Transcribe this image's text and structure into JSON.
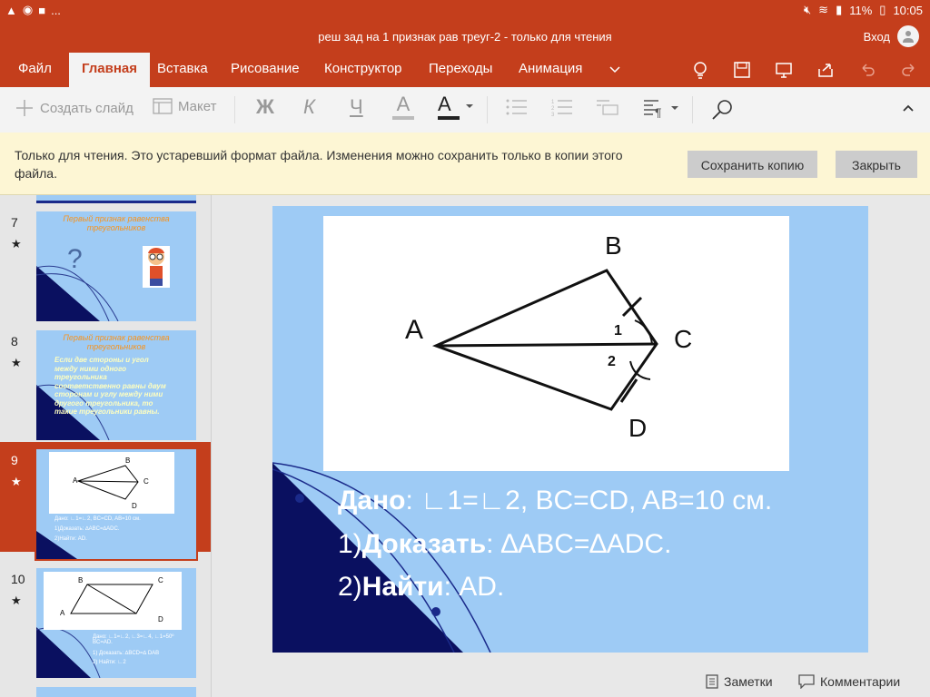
{
  "status": {
    "battery": "11%",
    "time": "10:05",
    "more": "..."
  },
  "window": {
    "title": "реш зад на 1 признак рав треуг-2 - только для чтения",
    "signin": "Вход"
  },
  "menu": {
    "tabs": [
      "Файл",
      "Главная",
      "Вставка",
      "Рисование",
      "Конструктор",
      "Переходы",
      "Анимация"
    ],
    "active": "Главная"
  },
  "toolbar": {
    "new_slide": "Создать слайд",
    "layout": "Макет",
    "bold": "Ж",
    "italic": "К",
    "underline": "Ч",
    "highlight": "A",
    "font_color": "A"
  },
  "notice": {
    "message": "Только для чтения. Это устаревший формат файла. Изменения можно сохранить только в копии этого файла.",
    "save_copy": "Сохранить копию",
    "close": "Закрыть"
  },
  "thumbnails": [
    {
      "num": "7",
      "title": "Первый признак равенства треугольников",
      "mark": "?"
    },
    {
      "num": "8",
      "title": "Первый признак равенства треугольников",
      "text": "Если две стороны и угол между ними одного треугольника соответственно равны двум сторонам и углу между ними другого треугольника, то такие треугольники равны."
    },
    {
      "num": "9",
      "line1": "Дано: ∟1=∟2, BC=CD, AB=10 см.",
      "line2": "1)Доказать: ∆ABC=∆ADC.",
      "line3": "2)Найти: AD."
    },
    {
      "num": "10",
      "line1": "Дано: ∟1=∟2, ∟3=∟4, ∟1=50º BC=AD.",
      "line2": "1) Доказать: ∆BCD=∆ DAB",
      "line3": "2) Найти: ∟2"
    }
  ],
  "slide": {
    "labels": {
      "a": "A",
      "b": "B",
      "c": "C",
      "d": "D",
      "one": "1",
      "two": "2"
    },
    "given_label": "Дано",
    "given_text": ": ∟1=∟2, BC=CD, AB=10 см.",
    "prove_prefix": "1)",
    "prove_label": "Доказать",
    "prove_text": ": ∆ABC=∆ADC.",
    "find_prefix": "2)",
    "find_label": "Найти",
    "find_text": ": AD."
  },
  "bottom": {
    "notes": "Заметки",
    "comments": "Комментарии"
  },
  "colors": {
    "accent": "#c43e1c",
    "slide_bg": "#9ecbf5",
    "notice_bg": "#fdf6d4"
  }
}
